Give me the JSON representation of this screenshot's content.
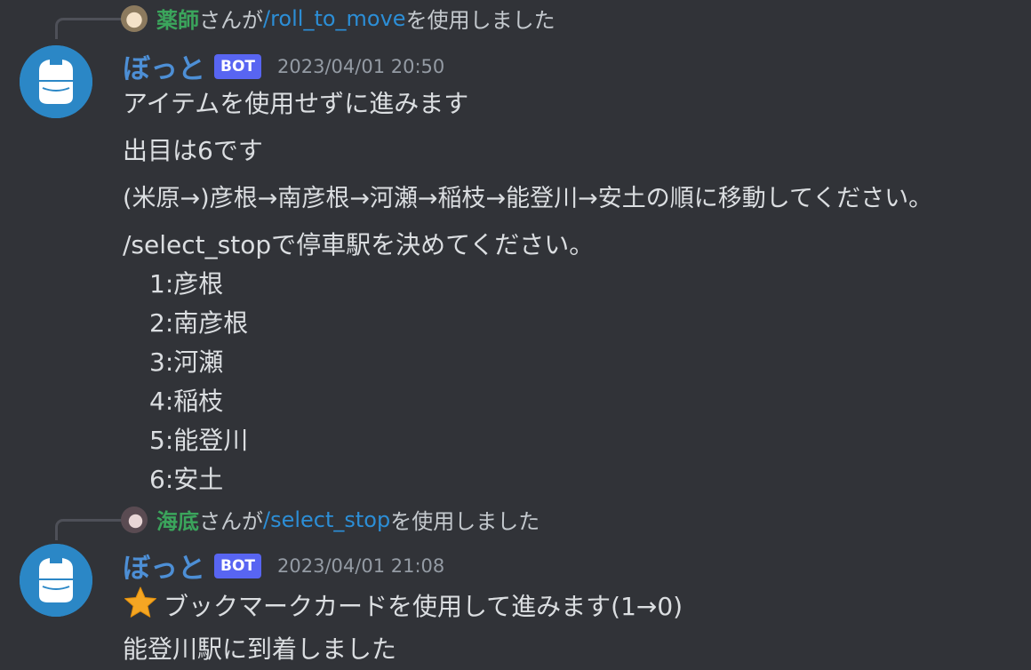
{
  "messages": [
    {
      "reference": {
        "user": "薬師",
        "mid": "さんが",
        "command": "/roll_to_move",
        "suffix": "を使用しました"
      },
      "author": "ぼっと",
      "bot_tag": "BOT",
      "timestamp": "2023/04/01 20:50",
      "lines": [
        "アイテムを使用せずに進みます",
        "出目は6です",
        "(米原→)彦根→南彦根→河瀬→稲枝→能登川→安土の順に移動してください。",
        "/select_stopで停車駅を決めてください。"
      ],
      "options": [
        "1:彦根",
        "2:南彦根",
        "3:河瀬",
        "4:稲枝",
        "5:能登川",
        "6:安土"
      ]
    },
    {
      "reference": {
        "user": "海底",
        "mid": "さんが",
        "command": "/select_stop",
        "suffix": "を使用しました"
      },
      "author": "ぼっと",
      "bot_tag": "BOT",
      "timestamp": "2023/04/01 21:08",
      "emoji": "star-icon",
      "lines": [
        "ブックマークカードを使用して進みます(1→0)",
        "能登川駅に到着しました"
      ]
    }
  ],
  "colors": {
    "background": "#313338",
    "author": "#4d8fd6",
    "reply_user": "#3ba55c",
    "command": "#2c8ed6",
    "bot_tag": "#5865f2"
  }
}
